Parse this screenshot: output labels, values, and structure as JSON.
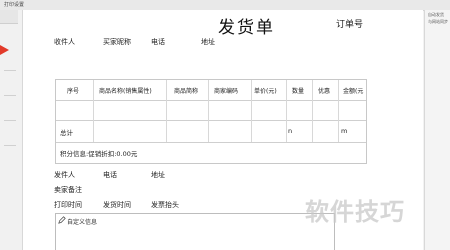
{
  "titlebar": {
    "label": "打印设置"
  },
  "document": {
    "title": "发货单",
    "order_no_label": "订单号"
  },
  "recipient_row": {
    "name": "收件人",
    "nickname": "买家昵称",
    "phone": "电话",
    "address": "地址"
  },
  "table": {
    "headers": [
      "序号",
      "商品名称(销售属性)",
      "商品简称",
      "商家编码",
      "单价(元)",
      "数量",
      "优惠",
      "金额(元"
    ],
    "total_label": "总计",
    "total_qty_marker": "n",
    "total_amount_marker": "m",
    "points_note": "积分信息:促销折扣:0.00元"
  },
  "sender_row": {
    "sender": "发件人",
    "phone": "电话",
    "address": "地址"
  },
  "seller_note": "卖家备注",
  "print_row": {
    "print_time": "打印时间",
    "ship_time": "发货时间",
    "invoice_title": "发票抬头"
  },
  "custom_info": "自定义信息",
  "right_panel": {
    "line1": "自动发货",
    "line2": "与网站同步"
  },
  "watermark": "软件技巧",
  "colors": {
    "arrow": "#e23a2a",
    "paper": "#ffffff",
    "border": "#c8c8c8"
  }
}
